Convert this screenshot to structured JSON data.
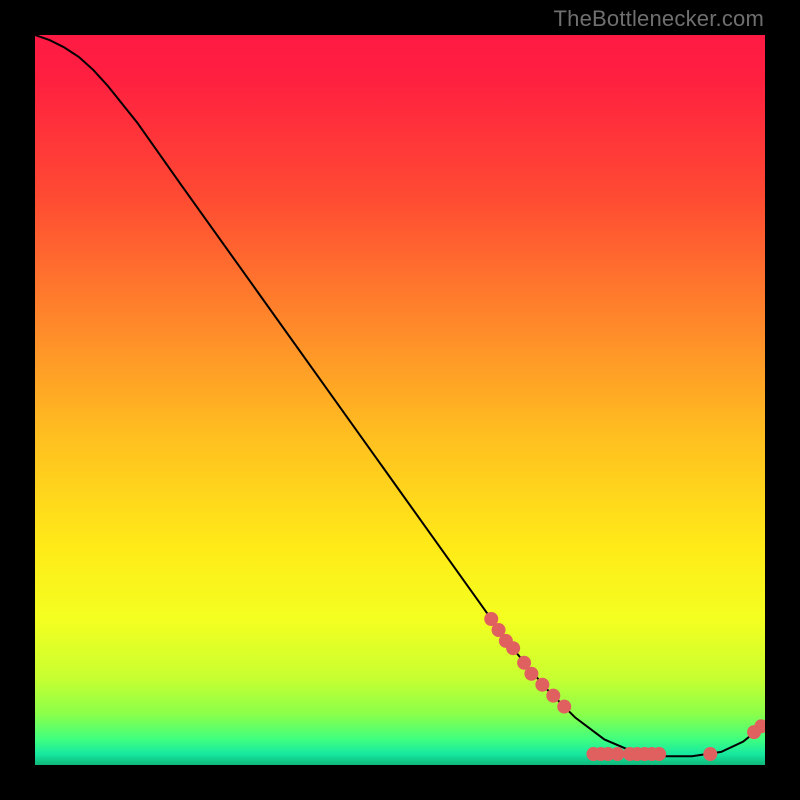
{
  "watermark": "TheBottlenecker.com",
  "chart_data": {
    "type": "line",
    "title": "",
    "xlabel": "",
    "ylabel": "",
    "xlim": [
      0,
      100
    ],
    "ylim": [
      0,
      100
    ],
    "grid": false,
    "gradient_stops": [
      {
        "offset": 0.0,
        "color": "#ff1a44"
      },
      {
        "offset": 0.06,
        "color": "#ff2040"
      },
      {
        "offset": 0.22,
        "color": "#ff4a33"
      },
      {
        "offset": 0.4,
        "color": "#ff8a2a"
      },
      {
        "offset": 0.55,
        "color": "#ffbf20"
      },
      {
        "offset": 0.7,
        "color": "#ffea18"
      },
      {
        "offset": 0.8,
        "color": "#f4ff20"
      },
      {
        "offset": 0.88,
        "color": "#c8ff30"
      },
      {
        "offset": 0.93,
        "color": "#8bff4a"
      },
      {
        "offset": 0.965,
        "color": "#3fff80"
      },
      {
        "offset": 0.985,
        "color": "#16e8a0"
      },
      {
        "offset": 1.0,
        "color": "#0fb87a"
      }
    ],
    "curve": [
      {
        "x": 0.0,
        "y": 100.0
      },
      {
        "x": 2.0,
        "y": 99.3
      },
      {
        "x": 4.0,
        "y": 98.3
      },
      {
        "x": 6.0,
        "y": 97.0
      },
      {
        "x": 8.0,
        "y": 95.2
      },
      {
        "x": 10.0,
        "y": 93.0
      },
      {
        "x": 14.0,
        "y": 88.0
      },
      {
        "x": 20.0,
        "y": 79.5
      },
      {
        "x": 30.0,
        "y": 65.5
      },
      {
        "x": 40.0,
        "y": 51.5
      },
      {
        "x": 50.0,
        "y": 37.5
      },
      {
        "x": 60.0,
        "y": 23.5
      },
      {
        "x": 65.0,
        "y": 16.5
      },
      {
        "x": 70.0,
        "y": 10.5
      },
      {
        "x": 74.0,
        "y": 6.5
      },
      {
        "x": 78.0,
        "y": 3.5
      },
      {
        "x": 82.0,
        "y": 1.8
      },
      {
        "x": 86.0,
        "y": 1.2
      },
      {
        "x": 90.0,
        "y": 1.2
      },
      {
        "x": 94.0,
        "y": 1.8
      },
      {
        "x": 97.0,
        "y": 3.2
      },
      {
        "x": 99.0,
        "y": 4.8
      },
      {
        "x": 100.0,
        "y": 5.6
      }
    ],
    "markers": [
      {
        "x": 62.5,
        "y": 20.0
      },
      {
        "x": 63.5,
        "y": 18.5
      },
      {
        "x": 64.5,
        "y": 17.0
      },
      {
        "x": 65.5,
        "y": 16.0
      },
      {
        "x": 67.0,
        "y": 14.0
      },
      {
        "x": 68.0,
        "y": 12.5
      },
      {
        "x": 69.5,
        "y": 11.0
      },
      {
        "x": 71.0,
        "y": 9.5
      },
      {
        "x": 72.5,
        "y": 8.0
      },
      {
        "x": 76.5,
        "y": 1.5
      },
      {
        "x": 77.5,
        "y": 1.5
      },
      {
        "x": 78.5,
        "y": 1.5
      },
      {
        "x": 79.8,
        "y": 1.5
      },
      {
        "x": 81.5,
        "y": 1.5
      },
      {
        "x": 82.5,
        "y": 1.5
      },
      {
        "x": 83.5,
        "y": 1.5
      },
      {
        "x": 84.5,
        "y": 1.5
      },
      {
        "x": 85.5,
        "y": 1.5
      },
      {
        "x": 92.5,
        "y": 1.5
      },
      {
        "x": 98.5,
        "y": 4.5
      },
      {
        "x": 99.5,
        "y": 5.3
      }
    ],
    "marker_color": "#e06060",
    "marker_radius": 7,
    "line_color": "#000000",
    "line_width": 2
  }
}
